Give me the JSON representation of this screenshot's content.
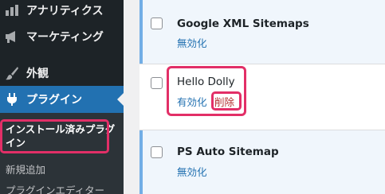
{
  "sidebar": {
    "items": [
      {
        "label": "アナリティクス",
        "icon": "analytics-bar-chart-icon"
      },
      {
        "label": "マーケティング",
        "icon": "megaphone-icon"
      },
      {
        "label": "外観",
        "icon": "paintbrush-icon"
      },
      {
        "label": "プラグイン",
        "icon": "plugins-plug-icon",
        "active": true
      }
    ],
    "submenu": {
      "current": "インストール済みプラグイン",
      "items": [
        "新規追加",
        "プラグインエディター"
      ]
    }
  },
  "plugins": [
    {
      "name": "Google XML Sitemaps",
      "actions": [
        "無効化"
      ],
      "status": "active"
    },
    {
      "name": "Hello Dolly",
      "actions": [
        "有効化",
        "削除"
      ],
      "status": "inactive"
    },
    {
      "name": "PS Auto Sitemap",
      "actions": [
        "無効化"
      ],
      "status": "active"
    }
  ],
  "colors": {
    "sidebar_bg": "#1d2327",
    "submenu_bg": "#2c3338",
    "accent_blue": "#2271b1",
    "highlight": "#e22f67",
    "delete_red": "#b32d2e"
  }
}
